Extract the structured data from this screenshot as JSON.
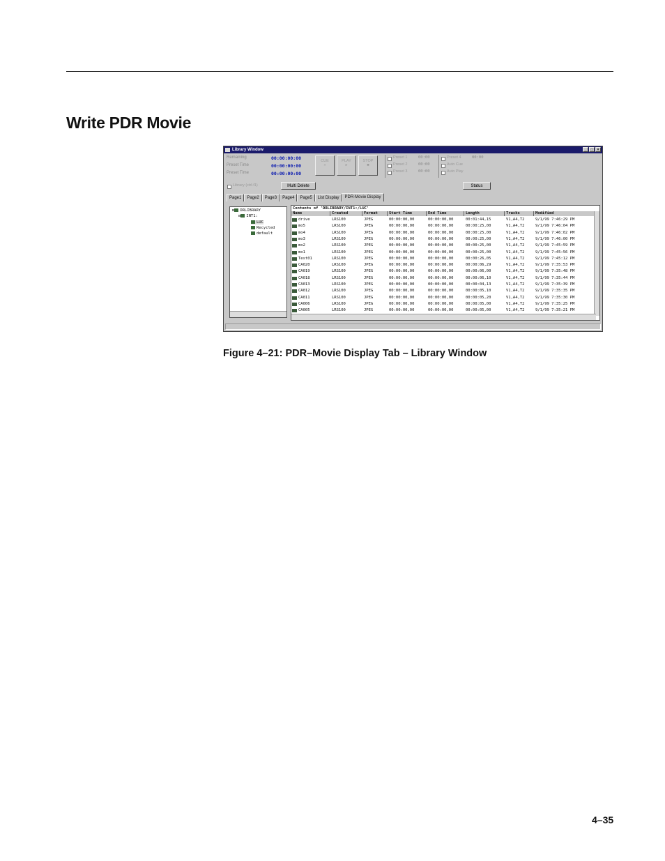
{
  "doc": {
    "section_title": "Write PDR Movie",
    "caption": "Figure 4–21: PDR–Movie Display Tab – Library Window",
    "page_number": "4–35"
  },
  "window": {
    "title": "Library Window",
    "title_buttons": [
      "_",
      "□",
      "×"
    ],
    "timecodes": [
      {
        "label": "Remaining",
        "value": "00:00:00:00"
      },
      {
        "label": "Preset Time",
        "value": "00:00:00:00"
      },
      {
        "label": "Preset Time",
        "value": "00:00:00:00"
      }
    ],
    "transport": [
      {
        "label": "CUE",
        "glyph": "»"
      },
      {
        "label": "PLAY",
        "glyph": "▸"
      },
      {
        "label": "STOP",
        "glyph": "■"
      }
    ],
    "checks_left": [
      {
        "label": "Preset 1",
        "value": "00:00"
      },
      {
        "label": "Preset 2",
        "value": "00:00"
      },
      {
        "label": "Preset 3",
        "value": "00:00"
      }
    ],
    "checks_right": [
      {
        "label": "Preset 4",
        "value": "00:00"
      },
      {
        "label": "Auto Cue",
        "value": ""
      },
      {
        "label": "Auto Play",
        "value": ""
      }
    ],
    "library_check": "Library (ctrl-f1)",
    "multi_delete": "Multi Delete",
    "status_btn": "Status",
    "tabs": [
      "Page1",
      "Page2",
      "Page3",
      "Page4",
      "Page5",
      "List Display",
      "PDR-Movie Display"
    ],
    "active_tab": "PDR-Movie Display",
    "tree": [
      {
        "label": "DRLIBRARY",
        "indent": 0
      },
      {
        "label": "INT1:",
        "indent": 1
      },
      {
        "label": "LUC",
        "indent": 2
      },
      {
        "label": "Recycled",
        "indent": 2
      },
      {
        "label": "default",
        "indent": 2
      }
    ],
    "contents_label": "Contents of 'DRLIBRARY/INT1:/LUC'",
    "columns": [
      "Name",
      "Created",
      "Format",
      "Start Time",
      "End Time",
      "Length",
      "Tracks",
      "Modified"
    ],
    "rows": [
      [
        "drive",
        "LRS100",
        "JPEG",
        "00:00:00,00",
        "00:00:00,00",
        "00:01:44,15",
        "V1,A4,T2",
        "9/1/99 7:46:29 PM"
      ],
      [
        "mo5",
        "LRS100",
        "JPEG",
        "00:00:00,00",
        "00:00:00,00",
        "00:00:25,00",
        "V1,A4,T2",
        "9/1/99 7:46:04 PM"
      ],
      [
        "mo4",
        "LRS100",
        "JPEG",
        "00:00:00,00",
        "00:00:00,00",
        "00:00:25,00",
        "V1,A4,T2",
        "9/1/99 7:46:02 PM"
      ],
      [
        "mo3",
        "LRS100",
        "JPEG",
        "00:00:00,00",
        "00:00:00,00",
        "00:00:25,00",
        "V1,A4,T2",
        "9/1/99 7:46:00 PM"
      ],
      [
        "mo2",
        "LRS100",
        "JPEG",
        "00:00:00,00",
        "00:00:00,00",
        "00:00:25,00",
        "V1,A4,T2",
        "9/1/99 7:45:59 PM"
      ],
      [
        "mo1",
        "LRS100",
        "JPEG",
        "00:00:00,00",
        "00:00:00,00",
        "00:00:25,00",
        "V1,A4,T2",
        "9/1/99 7:45:56 PM"
      ],
      [
        "Test01",
        "LRS100",
        "JPEG",
        "00:00:00,00",
        "00:00:00,00",
        "00:00:26,05",
        "V1,A4,T2",
        "9/1/99 7:45:12 PM"
      ],
      [
        "CA020",
        "LRS100",
        "JPEG",
        "00:00:00,00",
        "00:00:00,00",
        "00:00:06,29",
        "V1,A4,T2",
        "9/1/99 7:35:53 PM"
      ],
      [
        "CA019",
        "LRS100",
        "JPEG",
        "00:00:00,00",
        "00:00:00,00",
        "00:00:06,00",
        "V1,A4,T2",
        "9/1/99 7:35:48 PM"
      ],
      [
        "CA018",
        "LRS100",
        "JPEG",
        "00:00:00,00",
        "00:00:00,00",
        "00:00:06,10",
        "V1,A4,T2",
        "9/1/99 7:35:44 PM"
      ],
      [
        "CA013",
        "LRS100",
        "JPEG",
        "00:00:00,00",
        "00:00:00,00",
        "00:00:04,13",
        "V1,A4,T2",
        "9/1/99 7:35:39 PM"
      ],
      [
        "CA012",
        "LRS100",
        "JPEG",
        "00:00:00,00",
        "00:00:00,00",
        "00:00:05,10",
        "V1,A4,T2",
        "9/1/99 7:35:35 PM"
      ],
      [
        "CA011",
        "LRS100",
        "JPEG",
        "00:00:00,00",
        "00:00:00,00",
        "00:00:05,20",
        "V1,A4,T2",
        "9/1/99 7:35:30 PM"
      ],
      [
        "CA006",
        "LRS100",
        "JPEG",
        "00:00:00,00",
        "00:00:00,00",
        "00:00:05,00",
        "V1,A4,T2",
        "9/1/99 7:35:25 PM"
      ],
      [
        "CA005",
        "LRS100",
        "JPEG",
        "00:00:00,00",
        "00:00:00,00",
        "00:00:05,00",
        "V1,A4,T2",
        "9/1/99 7:35:21 PM"
      ]
    ]
  }
}
